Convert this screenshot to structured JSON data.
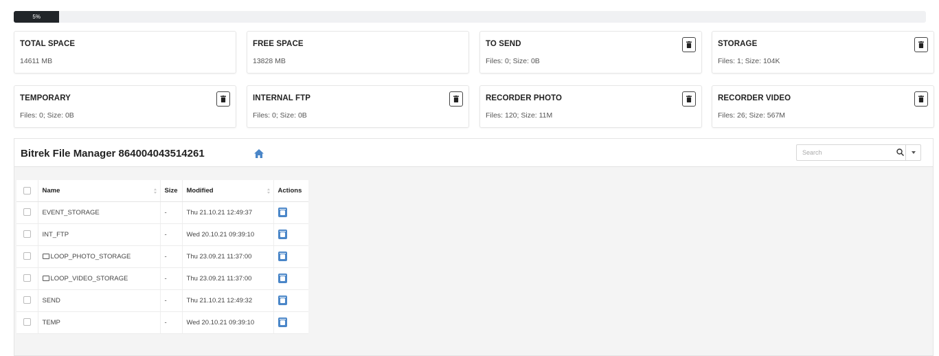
{
  "progress": {
    "label": "5%",
    "fraction": 0.05
  },
  "cards": [
    {
      "title": "TOTAL SPACE",
      "value": "14611 MB",
      "has_delete": false
    },
    {
      "title": "FREE SPACE",
      "value": "13828 MB",
      "has_delete": false
    },
    {
      "title": "TO SEND",
      "value": "Files: 0; Size: 0B",
      "has_delete": true
    },
    {
      "title": "STORAGE",
      "value": "Files: 1; Size: 104K",
      "has_delete": true
    },
    {
      "title": "TEMPORARY",
      "value": "Files: 0; Size: 0B",
      "has_delete": true
    },
    {
      "title": "INTERNAL FTP",
      "value": "Files: 0; Size: 0B",
      "has_delete": true
    },
    {
      "title": "RECORDER PHOTO",
      "value": "Files: 120; Size: 11M",
      "has_delete": true
    },
    {
      "title": "RECORDER VIDEO",
      "value": "Files: 26; Size: 567M",
      "has_delete": true
    }
  ],
  "file_manager": {
    "title": "Bitrek File Manager 864004043514261",
    "search": {
      "placeholder": "Search",
      "value": ""
    },
    "columns": {
      "name": "Name",
      "size": "Size",
      "modified": "Modified",
      "actions": "Actions"
    },
    "rows": [
      {
        "name": "EVENT_STORAGE",
        "folder": false,
        "size": "-",
        "modified": "Thu 21.10.21 12:49:37"
      },
      {
        "name": "INT_FTP",
        "folder": false,
        "size": "-",
        "modified": "Wed 20.10.21 09:39:10"
      },
      {
        "name": "LOOP_PHOTO_STORAGE",
        "folder": true,
        "size": "-",
        "modified": "Thu 23.09.21 11:37:00"
      },
      {
        "name": "LOOP_VIDEO_STORAGE",
        "folder": true,
        "size": "-",
        "modified": "Thu 23.09.21 11:37:00"
      },
      {
        "name": "SEND",
        "folder": false,
        "size": "-",
        "modified": "Thu 21.10.21 12:49:32"
      },
      {
        "name": "TEMP",
        "folder": false,
        "size": "-",
        "modified": "Wed 20.10.21 09:39:10"
      }
    ]
  },
  "icons": {
    "card_delete": "trash-icon",
    "home": "home-icon",
    "search": "search-icon",
    "dropdown": "chevron-down-icon",
    "row_action": "delete-icon",
    "folder": "folder-icon"
  },
  "colors": {
    "accent": "#4a86c8",
    "progress_fill": "#212529"
  }
}
